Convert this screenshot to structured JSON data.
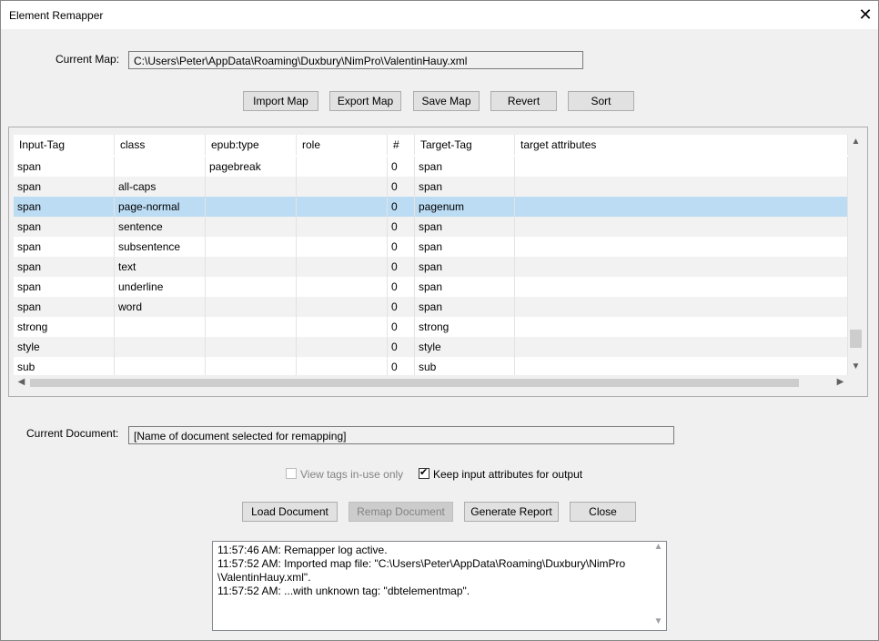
{
  "window": {
    "title": "Element Remapper"
  },
  "map": {
    "label": "Current Map:",
    "value": "C:\\Users\\Peter\\AppData\\Roaming\\Duxbury\\NimPro\\ValentinHauy.xml"
  },
  "map_buttons": {
    "import": "Import Map",
    "export": "Export Map",
    "save": "Save Map",
    "revert": "Revert",
    "sort": "Sort"
  },
  "grid": {
    "columns": [
      "Input-Tag",
      "class",
      "epub:type",
      "role",
      "#",
      "Target-Tag",
      "target attributes"
    ],
    "rows": [
      [
        "span",
        "",
        "pagebreak",
        "",
        "0",
        "span",
        ""
      ],
      [
        "span",
        "all-caps",
        "",
        "",
        "0",
        "span",
        ""
      ],
      [
        "span",
        "page-normal",
        "",
        "",
        "0",
        "pagenum",
        ""
      ],
      [
        "span",
        "sentence",
        "",
        "",
        "0",
        "span",
        ""
      ],
      [
        "span",
        "subsentence",
        "",
        "",
        "0",
        "span",
        ""
      ],
      [
        "span",
        "text",
        "",
        "",
        "0",
        "span",
        ""
      ],
      [
        "span",
        "underline",
        "",
        "",
        "0",
        "span",
        ""
      ],
      [
        "span",
        "word",
        "",
        "",
        "0",
        "span",
        ""
      ],
      [
        "strong",
        "",
        "",
        "",
        "0",
        "strong",
        ""
      ],
      [
        "style",
        "",
        "",
        "",
        "0",
        "style",
        ""
      ],
      [
        "sub",
        "",
        "",
        "",
        "0",
        "sub",
        ""
      ]
    ],
    "selected_row": 2,
    "colors": {
      "selected": "#bcdcf4",
      "alt_row": "#f2f2f2"
    }
  },
  "document": {
    "label": "Current Document:",
    "value": "[Name of document selected for remapping]"
  },
  "options": {
    "view_in_use": {
      "label": "View tags in-use only",
      "checked": false,
      "enabled": false
    },
    "keep_attrs": {
      "label": "Keep input attributes for output",
      "checked": true,
      "enabled": true
    }
  },
  "doc_buttons": {
    "load": "Load Document",
    "remap": "Remap Document",
    "report": "Generate Report",
    "close": "Close"
  },
  "log": {
    "lines": [
      "11:57:46 AM: Remapper log active.",
      "11:57:52 AM: Imported map file: \"C:\\Users\\Peter\\AppData\\Roaming\\Duxbury\\NimPro",
      "\\ValentinHauy.xml\".",
      "11:57:52 AM: ...with unknown tag: \"dbtelementmap\"."
    ]
  },
  "icons": {
    "close": "close-icon",
    "scroll_up": "chevron-up-icon",
    "scroll_down": "chevron-down-icon",
    "scroll_left": "chevron-left-icon",
    "scroll_right": "chevron-right-icon",
    "check": "checkmark-icon"
  }
}
